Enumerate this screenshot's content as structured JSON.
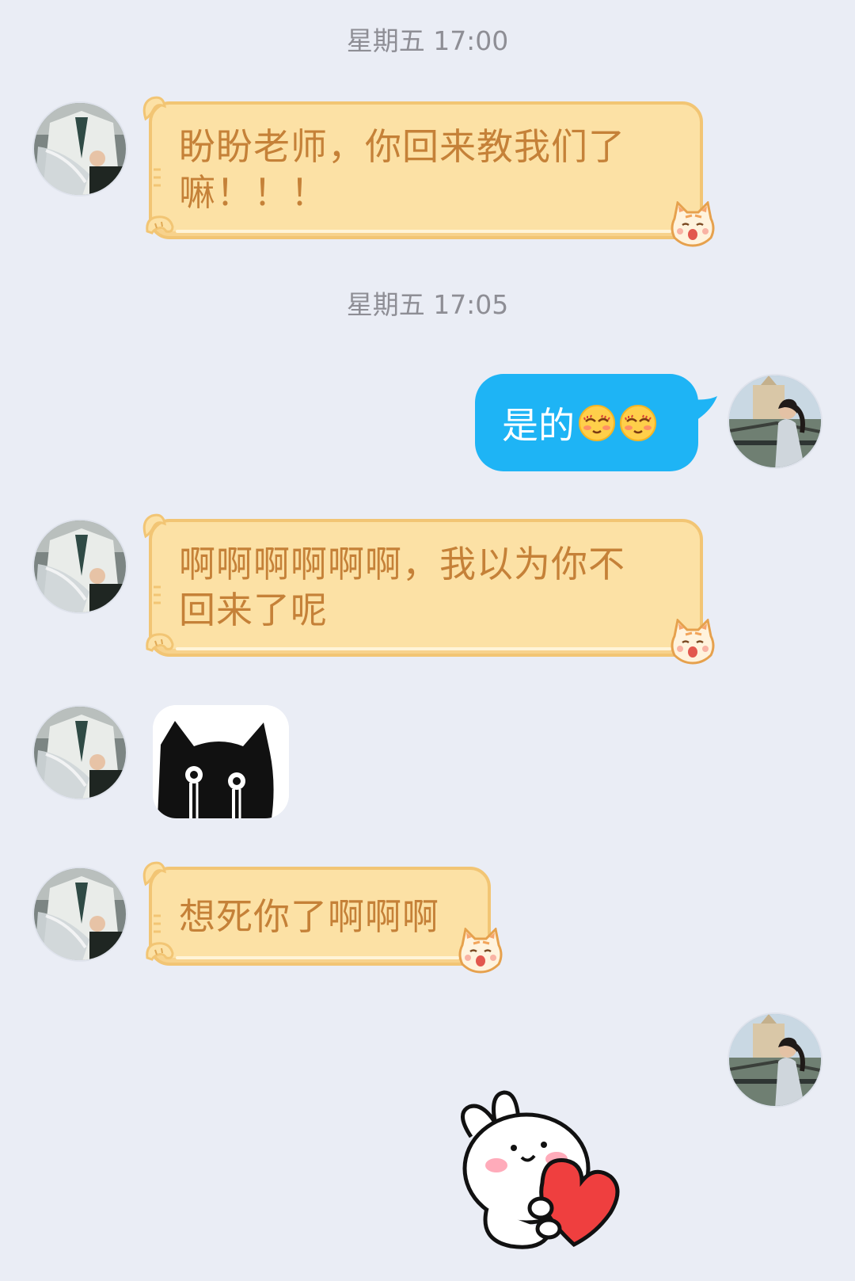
{
  "timestamps": [
    "星期五 17:00",
    "星期五 17:05"
  ],
  "messages": {
    "m1": {
      "sender": "them",
      "text_line1": "盼盼老师，你回来教我们了",
      "text_line2": "嘛！！！"
    },
    "m2": {
      "sender": "me",
      "text": "是的",
      "emoji": [
        "blushing-face-emoji",
        "blushing-face-emoji"
      ]
    },
    "m3": {
      "sender": "them",
      "text_line1": "啊啊啊啊啊啊，我以为你不",
      "text_line2": "回来了呢"
    },
    "m4": {
      "sender": "them",
      "sticker": "black-cat-sticker"
    },
    "m5": {
      "sender": "them",
      "text": "想死你了啊啊啊"
    },
    "m6": {
      "sender": "me",
      "sticker": "bunny-heart-sticker"
    }
  },
  "colors": {
    "background": "#eaedf5",
    "incoming_bubble": "#fce1a5",
    "incoming_border": "#f2c574",
    "incoming_text": "#c58138",
    "outgoing_bubble": "#1eb4f5",
    "outgoing_text": "#ffffff",
    "timestamp": "#8e8e95"
  }
}
